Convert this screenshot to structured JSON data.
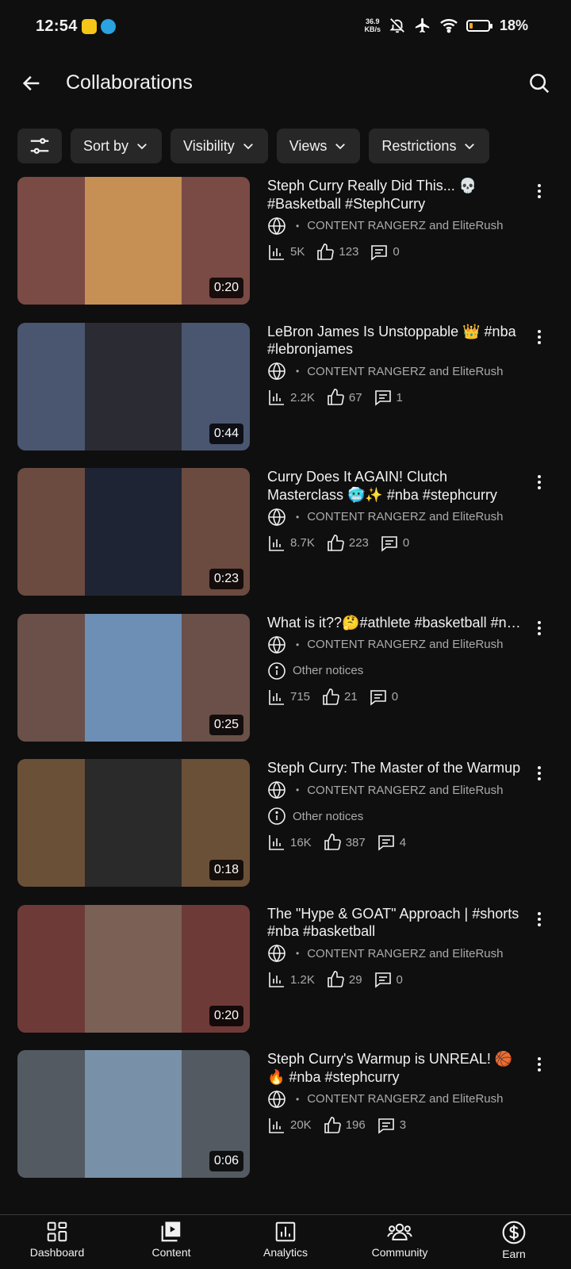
{
  "status": {
    "time": "12:54",
    "net_speed_top": "36.9",
    "net_speed_bottom": "KB/s",
    "battery_pct": "18%",
    "battery_level": 0.18
  },
  "header": {
    "title": "Collaborations"
  },
  "filters": {
    "sort": "Sort by",
    "visibility": "Visibility",
    "views": "Views",
    "restrictions": "Restrictions"
  },
  "videos": [
    {
      "title": "Steph Curry Really Did This... 💀 #Basketball #StephCurry",
      "collab": "CONTENT RANGERZ and EliteRush",
      "views": "5K",
      "likes": "123",
      "comments": "0",
      "duration": "0:20",
      "bg": "#7a4a45",
      "center": "#c69055"
    },
    {
      "title": "LeBron James Is Unstoppable 👑 #nba #lebronjames",
      "collab": "CONTENT RANGERZ and EliteRush",
      "views": "2.2K",
      "likes": "67",
      "comments": "1",
      "duration": "0:44",
      "bg": "#4a5670",
      "center": "#2b2b33"
    },
    {
      "title": "Curry Does It AGAIN! Clutch Masterclass 🥶✨  #nba #stephcurry",
      "collab": "CONTENT RANGERZ and EliteRush",
      "views": "8.7K",
      "likes": "223",
      "comments": "0",
      "duration": "0:23",
      "bg": "#6b4a40",
      "center": "#1e2433"
    },
    {
      "title": "What is it??🤔#athlete #basketball #nba",
      "collab": "CONTENT RANGERZ and EliteRush",
      "notice": "Other notices",
      "views": "715",
      "likes": "21",
      "comments": "0",
      "duration": "0:25",
      "bg": "#6a5048",
      "center": "#6d8fb5"
    },
    {
      "title": "Steph Curry: The Master of the Warmup",
      "collab": "CONTENT RANGERZ and EliteRush",
      "notice": "Other notices",
      "views": "16K",
      "likes": "387",
      "comments": "4",
      "duration": "0:18",
      "bg": "#6b5038",
      "center": "#2a2a2a"
    },
    {
      "title": "The \"Hype & GOAT\" Approach | #shorts #nba #basketball",
      "collab": "CONTENT RANGERZ and EliteRush",
      "views": "1.2K",
      "likes": "29",
      "comments": "0",
      "duration": "0:20",
      "bg": "#6e3a38",
      "center": "#7a6055"
    },
    {
      "title": "Steph Curry's Warmup is UNREAL! 🏀🔥 #nba #stephcurry",
      "collab": "CONTENT RANGERZ and EliteRush",
      "views": "20K",
      "likes": "196",
      "comments": "3",
      "duration": "0:06",
      "bg": "#535a62",
      "center": "#7890a8"
    }
  ],
  "nav": {
    "dashboard": "Dashboard",
    "content": "Content",
    "analytics": "Analytics",
    "community": "Community",
    "earn": "Earn"
  }
}
